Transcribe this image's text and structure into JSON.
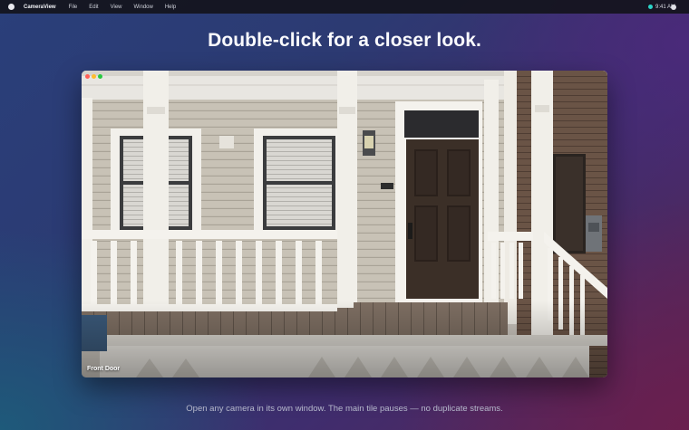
{
  "menubar": {
    "app_name": "CameraView",
    "items": [
      "File",
      "Edit",
      "View",
      "Window",
      "Help"
    ],
    "clock": "9:41 AM"
  },
  "headline": "Double-click for a closer look.",
  "camera_window": {
    "label": "Front Door",
    "traffic_lights": [
      "#ff5f57",
      "#febc2e",
      "#28c840"
    ]
  },
  "caption": "Open any camera in its own window. The main tile pauses — no duplicate streams.",
  "colors": {
    "status_dot": "#2bd4c8",
    "door": "#3b2f27",
    "siding": "#c9c3b8",
    "trim": "#f1efe9"
  }
}
